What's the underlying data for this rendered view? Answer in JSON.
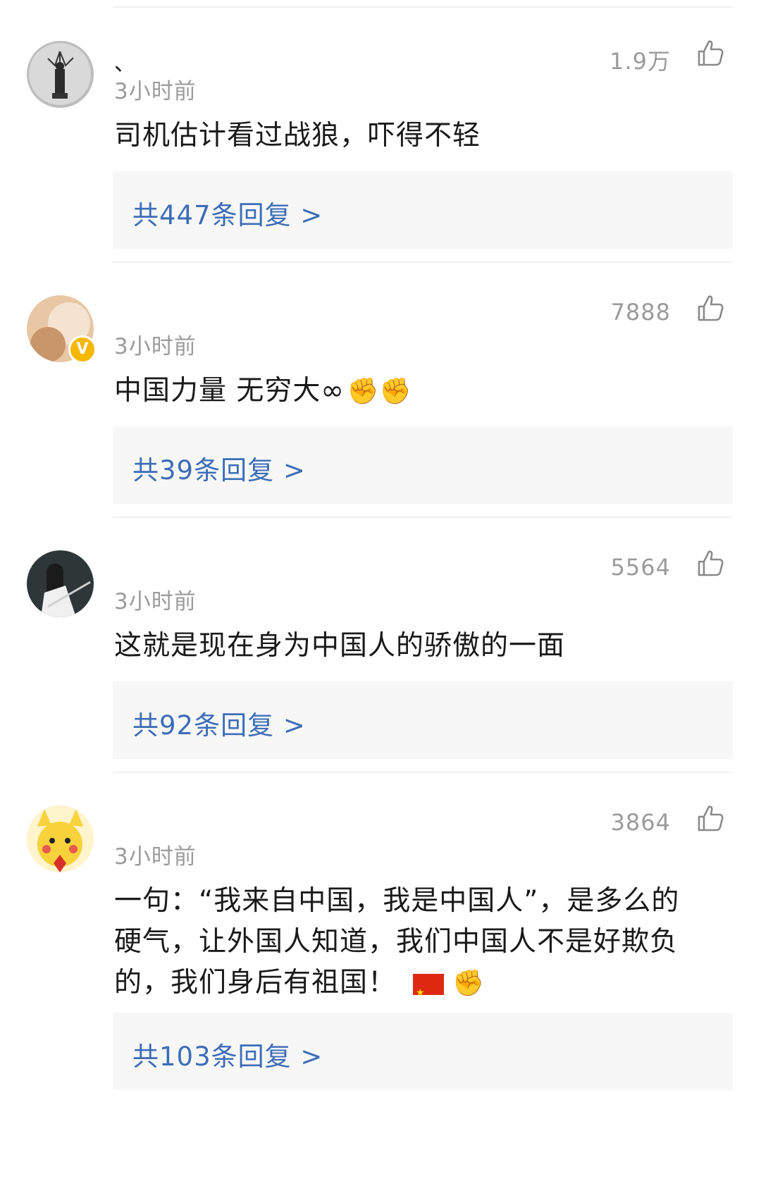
{
  "comments": [
    {
      "username": "、",
      "time": "3小时前",
      "likes": "1.9万",
      "text": "司机估计看过战狼，吓得不轻",
      "replies": "共447条回复 >"
    },
    {
      "username": "",
      "time": "3小时前",
      "likes": "7888",
      "text": "中国力量 无穷大∞",
      "emoji": "✊✊",
      "verified": true,
      "replies": "共39条回复 >"
    },
    {
      "username": "",
      "time": "3小时前",
      "likes": "5564",
      "text": "这就是现在身为中国人的骄傲的一面",
      "replies": "共92条回复 >"
    },
    {
      "username": "",
      "time": "3小时前",
      "likes": "3864",
      "text_lines": [
        "一句：“我来自中国，我是中国人”，是多么的",
        "硬气，让外国人知道，我们中国人不是好欺负",
        "的，我们身后有祖国！"
      ],
      "emoji": "✊",
      "replies": "共103条回复 >"
    }
  ],
  "icons": {
    "like": "thumbs-up-outline-icon",
    "verified": "verified-v-badge-icon"
  },
  "colors": {
    "link": "#3d6db7",
    "meta": "#9b9b9b",
    "reply_bg": "#f7f7f7",
    "badge": "#f5b800"
  }
}
